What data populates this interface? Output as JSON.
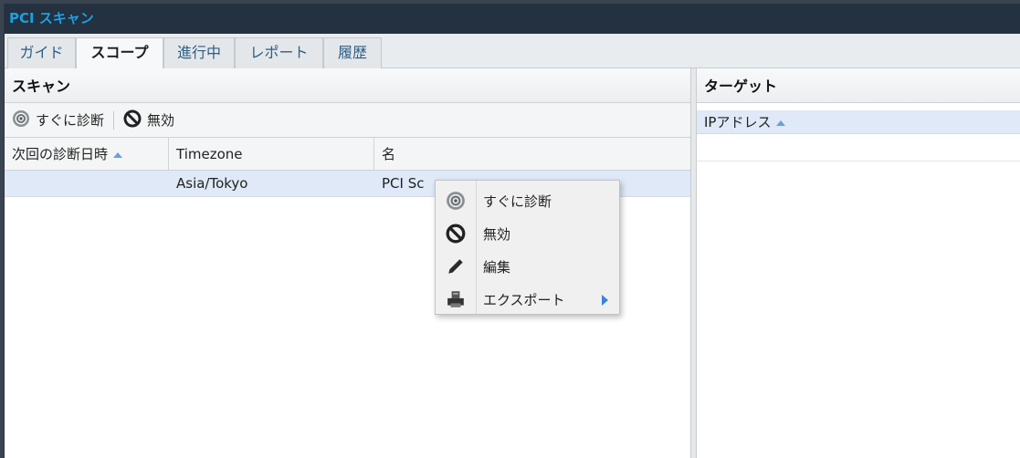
{
  "window": {
    "title": "PCI スキャン"
  },
  "tabs": [
    {
      "label": "ガイド"
    },
    {
      "label": "スコープ"
    },
    {
      "label": "進行中"
    },
    {
      "label": "レポート"
    },
    {
      "label": "履歴"
    }
  ],
  "scan_panel": {
    "title": "スキャン",
    "toolbar": {
      "scan_now_label": "すぐに診断",
      "disable_label": "無効"
    },
    "columns": [
      "次回の診断日時",
      "Timezone",
      "名"
    ],
    "rows": [
      {
        "next_scan": "",
        "timezone": "Asia/Tokyo",
        "name": "PCI Sc"
      }
    ]
  },
  "target_panel": {
    "title": "ターゲット",
    "columns": [
      "IPアドレス"
    ]
  },
  "context_menu": {
    "items": [
      {
        "label": "すぐに診断",
        "icon": "scan-icon"
      },
      {
        "label": "無効",
        "icon": "disable-icon"
      },
      {
        "label": "編集",
        "icon": "pencil-icon"
      },
      {
        "label": "エクスポート",
        "icon": "export-icon",
        "submenu": true
      }
    ]
  },
  "colors": {
    "title_bg": "#233140",
    "title_text": "#1f9fe0",
    "selection": "#dfe9f7",
    "accent": "#3b84d6"
  }
}
